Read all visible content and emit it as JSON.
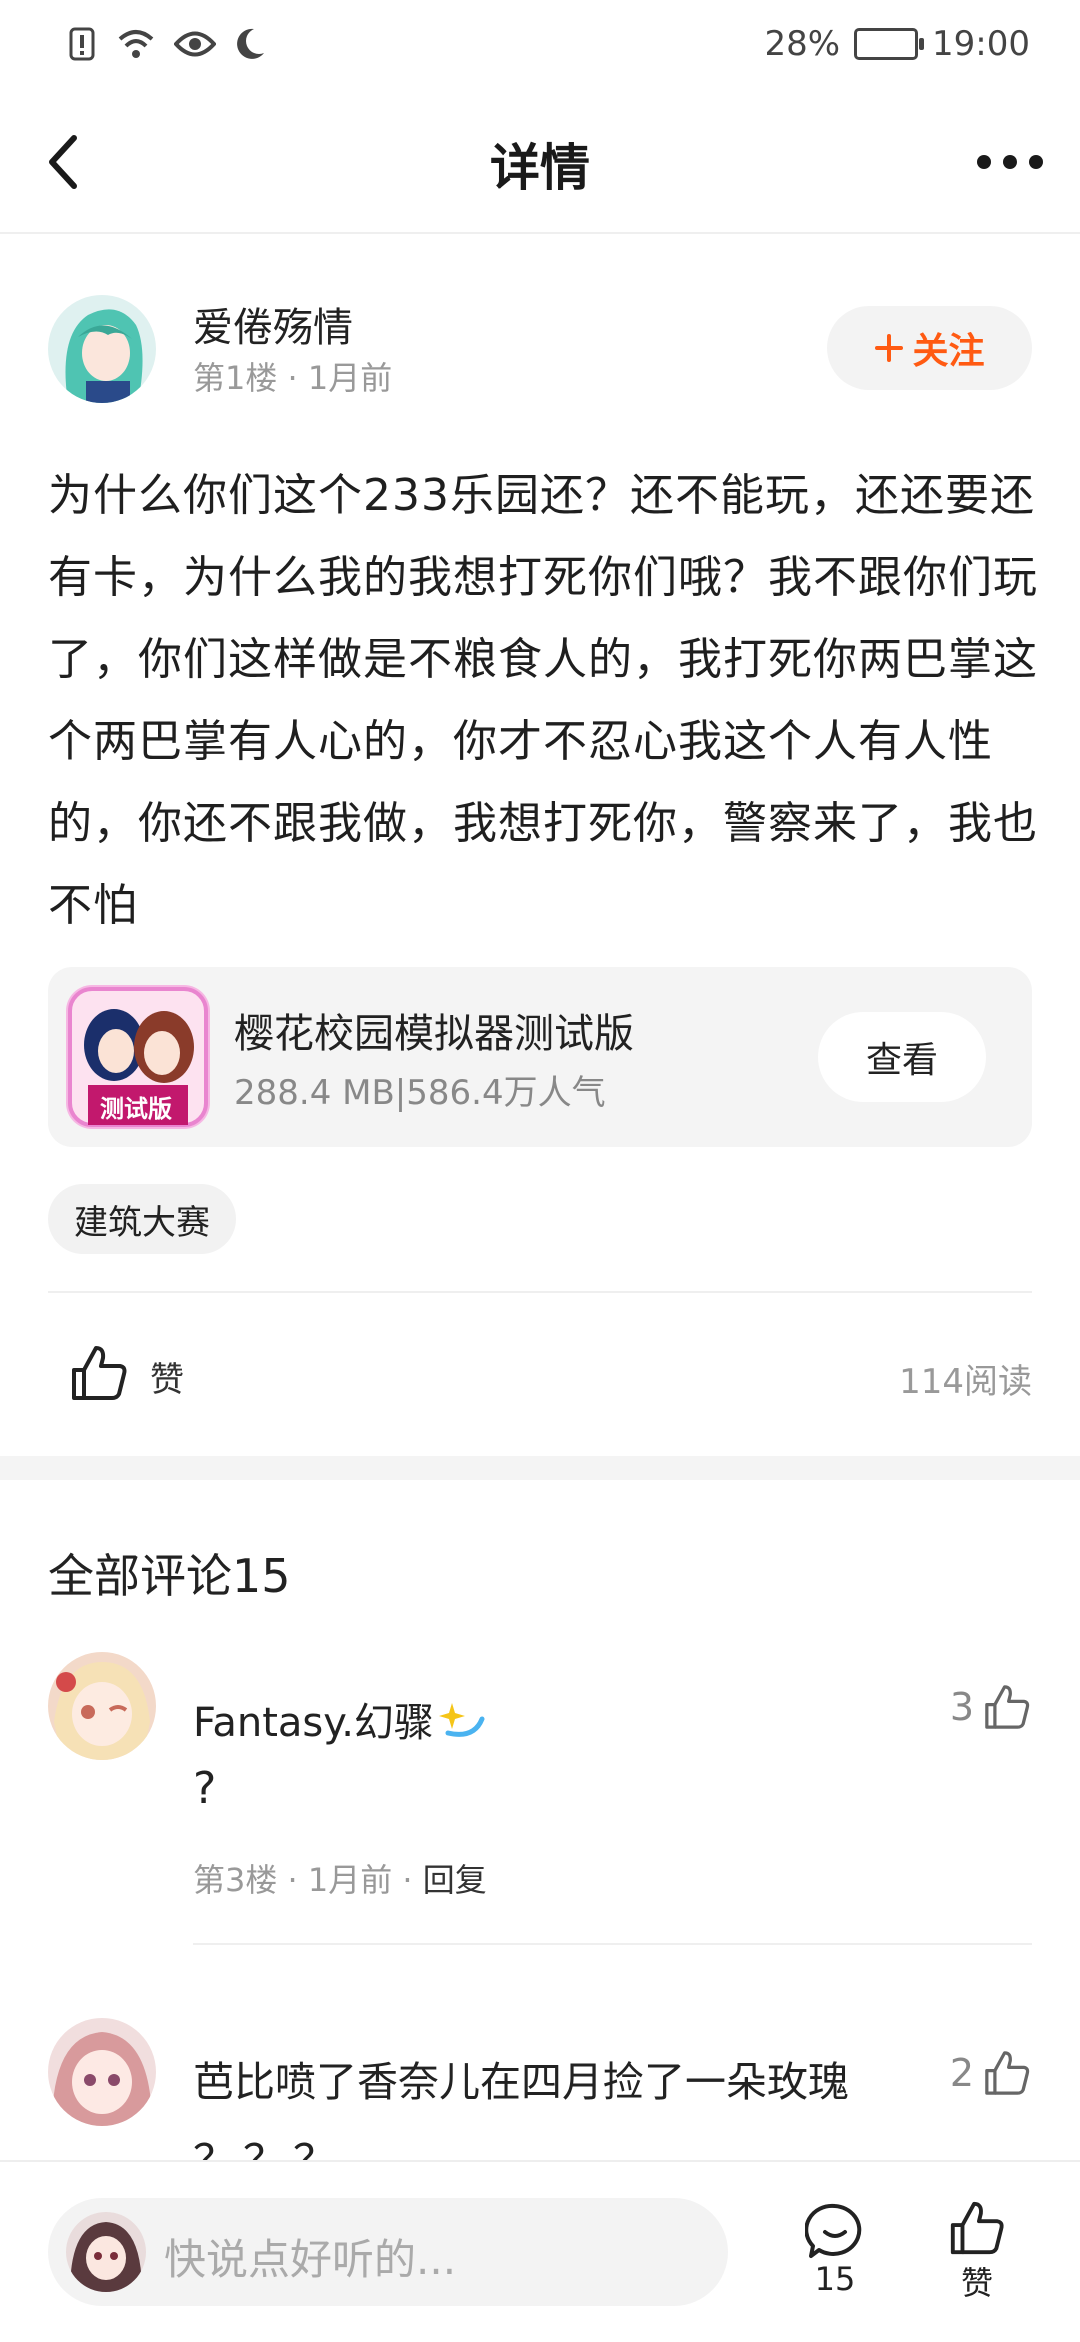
{
  "status": {
    "battery": "28%",
    "time": "19:00"
  },
  "header": {
    "title": "详情"
  },
  "post": {
    "author": "爱倦殇情",
    "meta": "第1楼 · 1月前",
    "follow_label": "关注",
    "text": "为什么你们这个233乐园还？还不能玩，还还要还有卡，为什么我的我想打死你们哦？我不跟你们玩了，你们这样做是不粮食人的，我打死你两巴掌这个两巴掌有人心的，你才不忍心我这个人有人性的，你还不跟我做，我想打死你，警察来了，我也不怕",
    "app": {
      "name": "樱花校园模拟器测试版",
      "info": "288.4 MB|586.4万人气",
      "badge": "测试版",
      "view_label": "查看"
    },
    "tag": "建筑大赛",
    "like_label": "赞",
    "read_count": "114阅读"
  },
  "comments": {
    "title": "全部评论15",
    "items": [
      {
        "name": "Fantasy.幻骤",
        "text": "?",
        "meta": "第3楼 · 1月前 · ",
        "reply": "回复",
        "likes": "3"
      },
      {
        "name": "芭比喷了香奈儿在四月捡了一朵玫瑰",
        "text": "？？？",
        "likes": "2"
      }
    ]
  },
  "bottom": {
    "placeholder": "快说点好听的...",
    "comment_count": "15",
    "like_label": "赞"
  },
  "colors": {
    "accent": "#ff5a12",
    "muted": "#999999"
  }
}
